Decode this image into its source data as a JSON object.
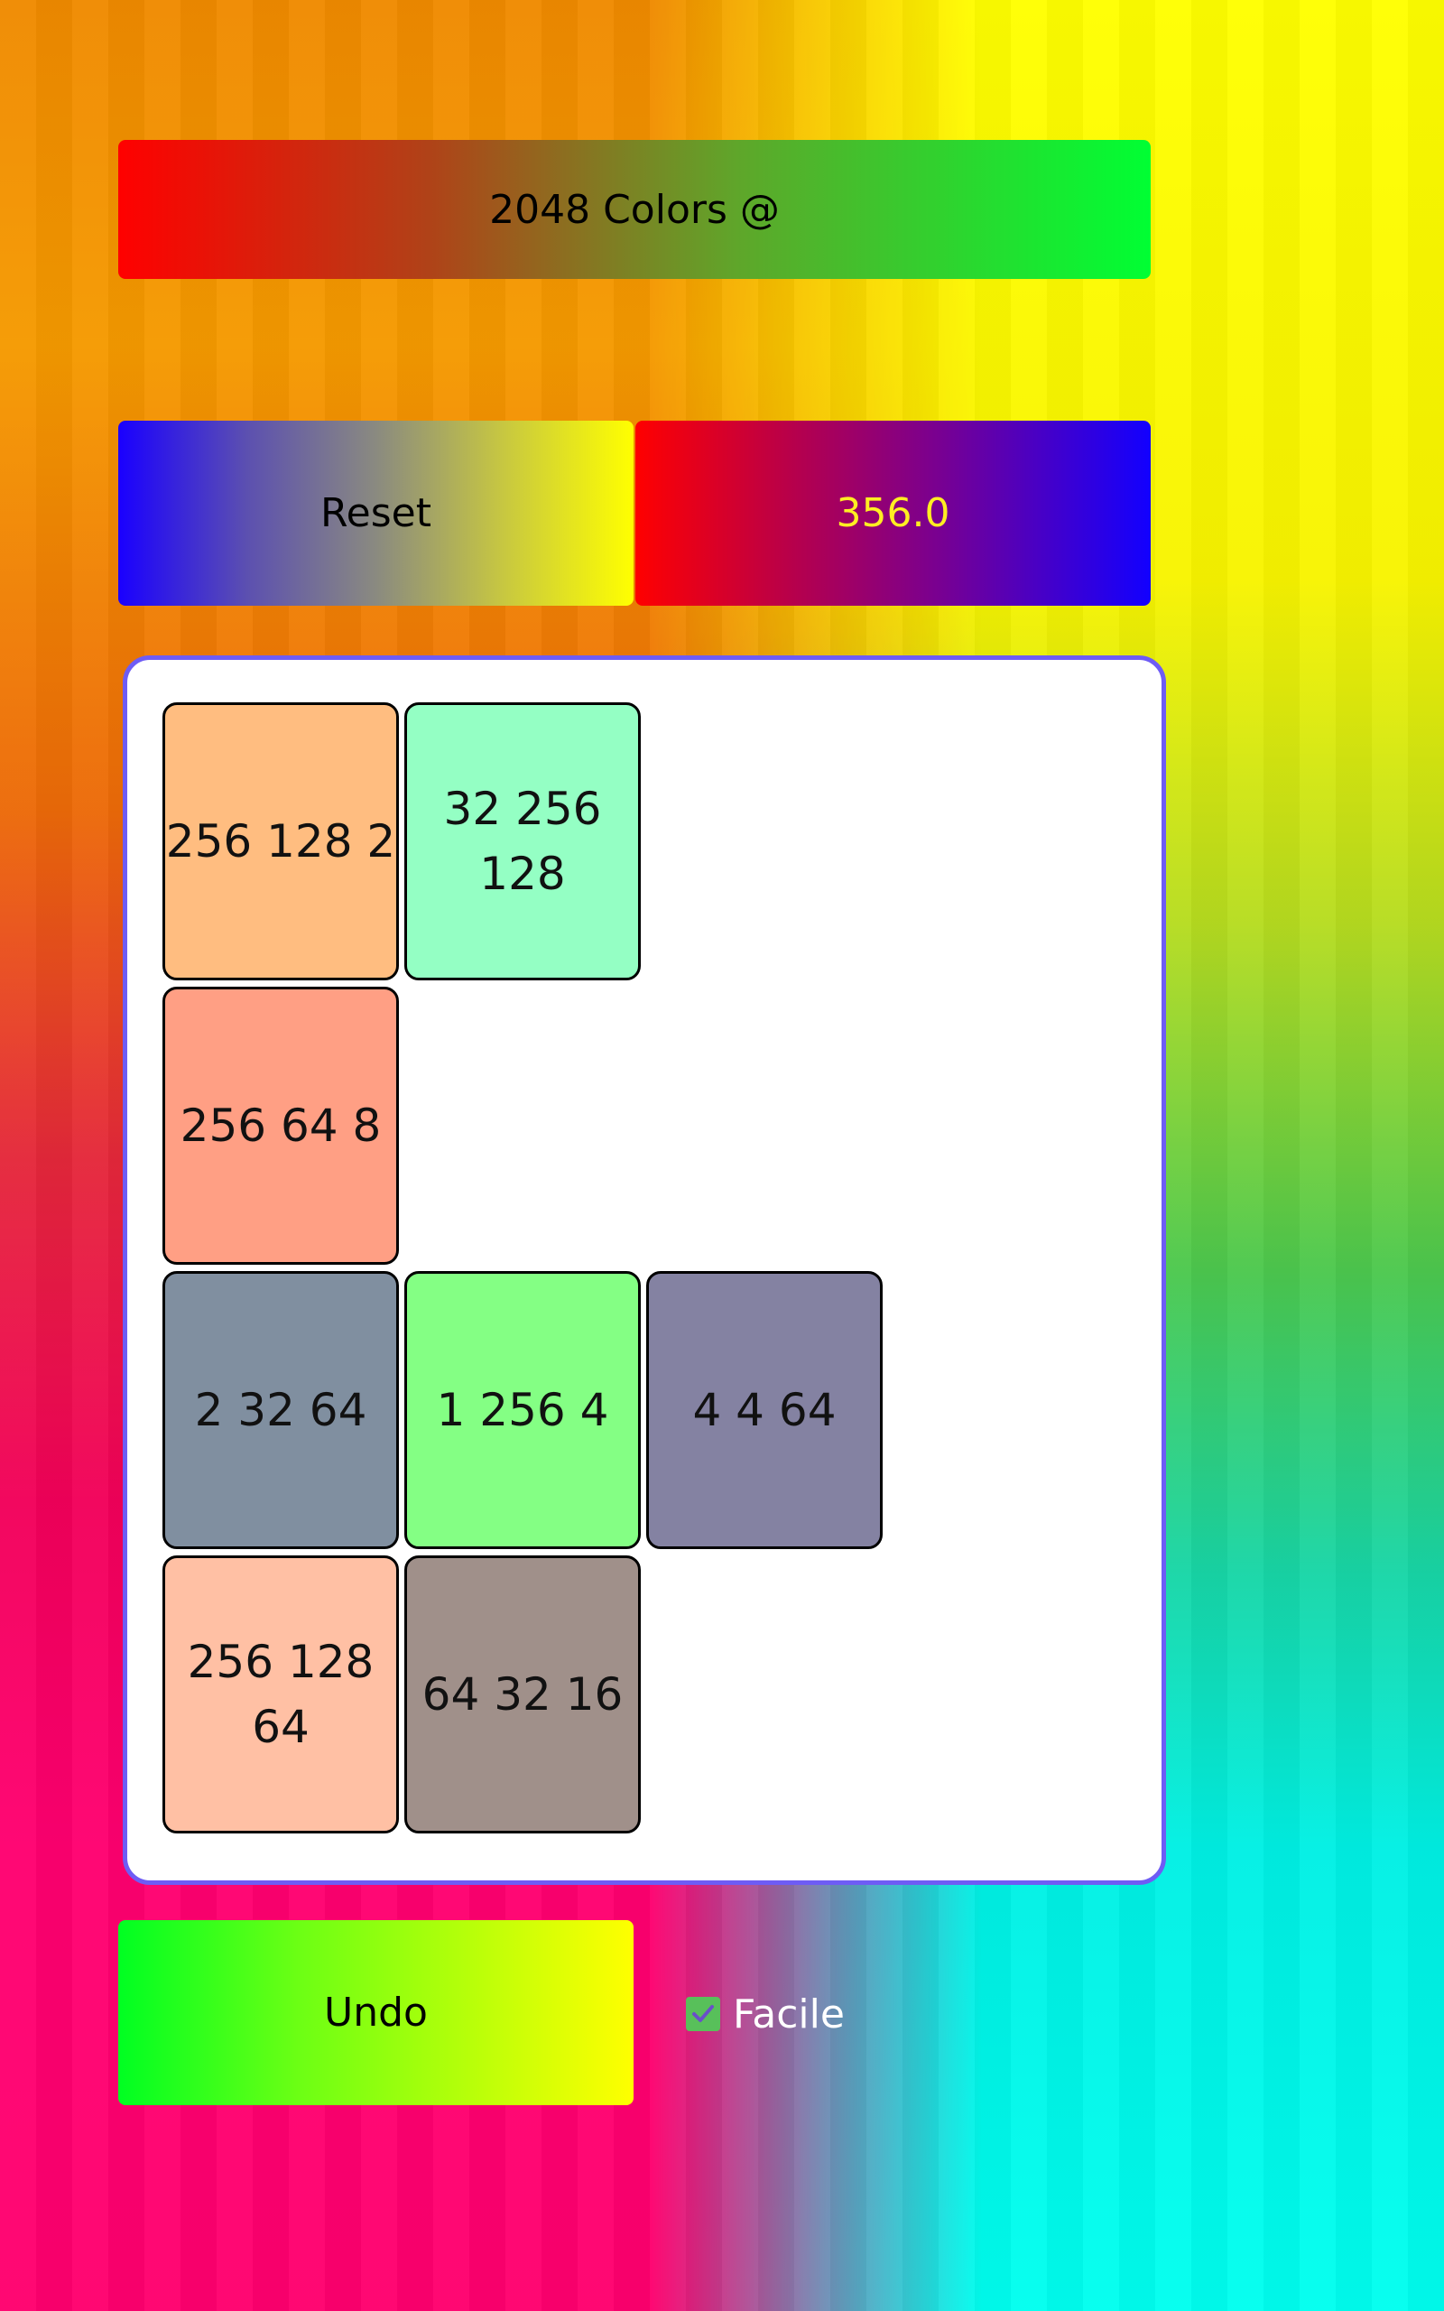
{
  "header": {
    "title": "2048 Colors @"
  },
  "controls": {
    "reset_label": "Reset",
    "score": "356.0",
    "undo_label": "Undo",
    "easy_mode": {
      "label": "Facile",
      "checked": true
    }
  },
  "theme": {
    "board_border": "#6e5cf5",
    "checkbox_color": "#58c05a",
    "score_text_color": "#ffee22"
  },
  "board": {
    "columns": 4,
    "tiles": [
      {
        "row": 0,
        "col": 0,
        "text": "256 128 2",
        "color": "#ffbd80"
      },
      {
        "row": 0,
        "col": 1,
        "text": "32 256 128",
        "color": "#94ffc4"
      },
      {
        "row": 1,
        "col": 0,
        "text": "256 64 8",
        "color": "#ff9f84"
      },
      {
        "row": 2,
        "col": 0,
        "text": "2 32 64",
        "color": "#808fa0"
      },
      {
        "row": 2,
        "col": 1,
        "text": "1 256 4",
        "color": "#84ff84"
      },
      {
        "row": 2,
        "col": 2,
        "text": "4 4 64",
        "color": "#8482a2"
      },
      {
        "row": 3,
        "col": 0,
        "text": "256 128 64",
        "color": "#ffc0a4"
      },
      {
        "row": 3,
        "col": 1,
        "text": "64 32 16",
        "color": "#a0908a"
      }
    ]
  }
}
